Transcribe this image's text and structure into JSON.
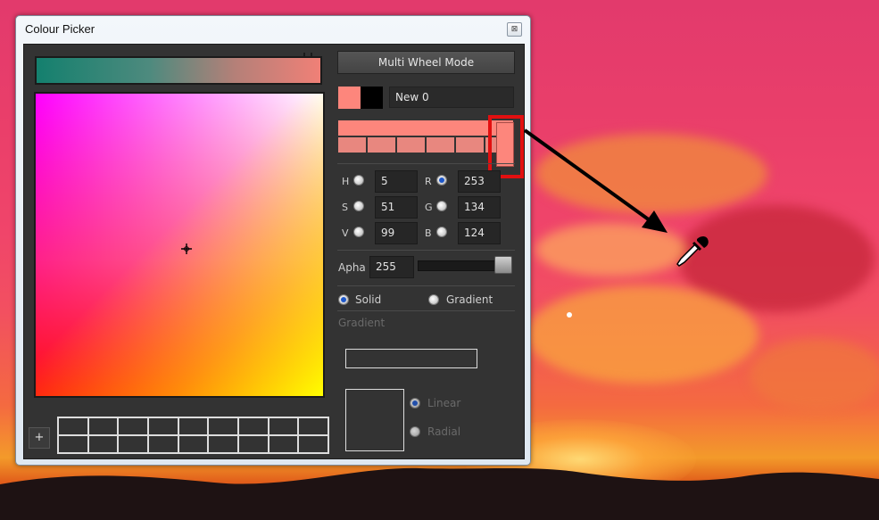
{
  "window": {
    "title": "Colour Picker",
    "close_glyph": "⊠"
  },
  "toolbar": {
    "mode_button": "Multi Wheel Mode"
  },
  "swatch": {
    "name": "New 0",
    "current_color": "#fd867c",
    "previous_color": "#000000"
  },
  "hsv": {
    "h_label": "H",
    "h_value": "5",
    "s_label": "S",
    "s_value": "51",
    "v_label": "V",
    "v_value": "99"
  },
  "rgb": {
    "r_label": "R",
    "r_value": "253",
    "g_label": "G",
    "g_value": "134",
    "b_label": "B",
    "b_value": "124",
    "active": "R"
  },
  "alpha": {
    "label": "Apha",
    "value": "255",
    "level": 1.0
  },
  "fill_mode": {
    "solid_label": "Solid",
    "gradient_label": "Gradient",
    "selected": "Solid"
  },
  "gradient_section": {
    "heading": "Gradient",
    "linear_label": "Linear",
    "radial_label": "Radial",
    "selected": "Linear"
  },
  "palette": {
    "add_label": "+",
    "columns": 9,
    "rows": 2
  },
  "icons": {
    "crosshair": "crosshair-icon",
    "eyedropper": "eyedropper-icon",
    "arrow": "arrow-annotation"
  },
  "colors": {
    "highlight_box": "#e20f10"
  }
}
